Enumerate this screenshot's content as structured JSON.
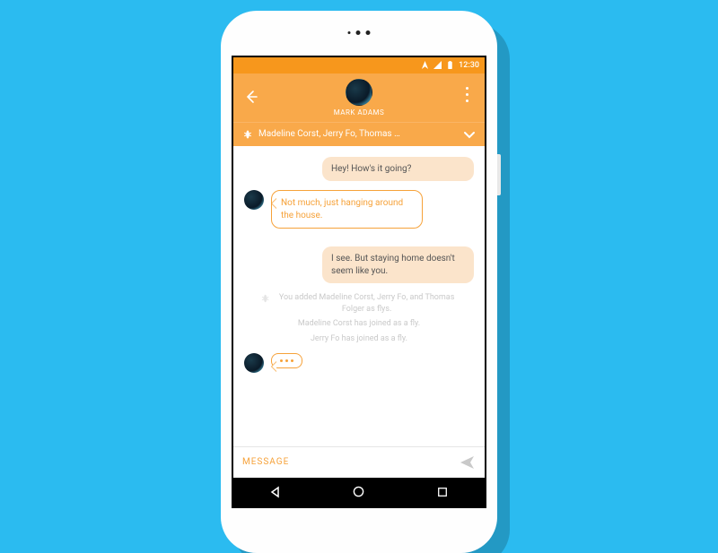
{
  "status": {
    "time": "12:30"
  },
  "header": {
    "contact_name": "MARK ADAMS",
    "participants_label": "Madeline Corst, Jerry Fo, Thomas …"
  },
  "messages": {
    "out1": "Hey! How's it going?",
    "in1": "Not much, just hanging around the house.",
    "out2": "I see. But staying home doesn't seem like you."
  },
  "system": {
    "s1": "You added Madeline Corst, Jerry Fo, and Thomas Folger as flys.",
    "s2": "Madeline Corst has joined as a fly.",
    "s3": "Jerry Fo has joined as a fly."
  },
  "composer": {
    "placeholder": "MESSAGE"
  }
}
